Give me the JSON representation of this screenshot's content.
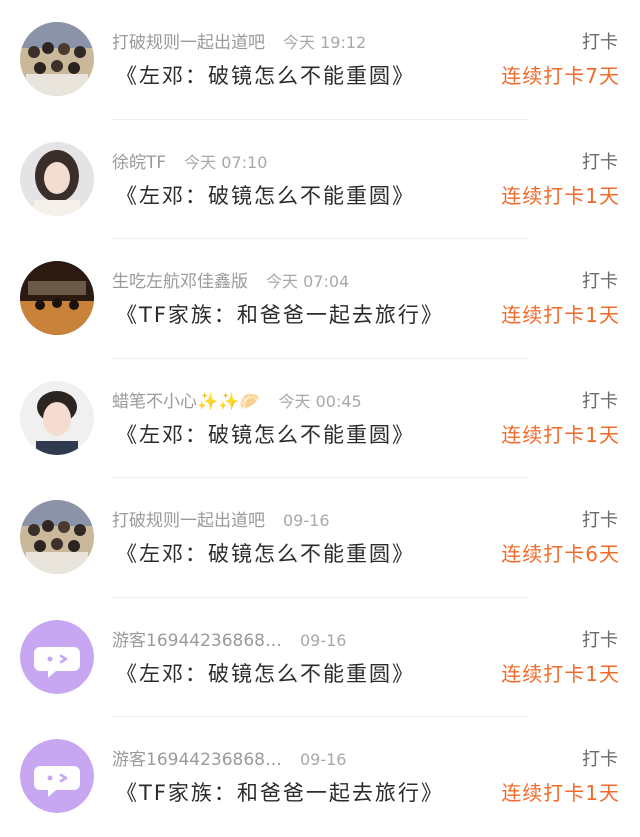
{
  "checkins": [
    {
      "avatar": "group-photo",
      "user": "打破规则一起出道吧",
      "time": "今天 19:12",
      "title": "《左邓：破镜怎么不能重圆》",
      "tag": "打卡",
      "streak": "连续打卡7天"
    },
    {
      "avatar": "girl-photo",
      "user": "徐皖TF",
      "time": "今天 07:10",
      "title": "《左邓：破镜怎么不能重圆》",
      "tag": "打卡",
      "streak": "连续打卡1天"
    },
    {
      "avatar": "stage-photo",
      "user": "生吃左航邓佳鑫版",
      "time": "今天 07:04",
      "title": "《TF家族：和爸爸一起去旅行》",
      "tag": "打卡",
      "streak": "连续打卡1天"
    },
    {
      "avatar": "boy-photo",
      "user": "蜡笔不小心✨✨🥟",
      "time": "今天 00:45",
      "title": "《左邓：破镜怎么不能重圆》",
      "tag": "打卡",
      "streak": "连续打卡1天"
    },
    {
      "avatar": "group-photo",
      "user": "打破规则一起出道吧",
      "time": "09-16",
      "title": "《左邓：破镜怎么不能重圆》",
      "tag": "打卡",
      "streak": "连续打卡6天"
    },
    {
      "avatar": "chat-bubble-icon",
      "user": "游客16944236868…",
      "time": "09-16",
      "title": "《左邓：破镜怎么不能重圆》",
      "tag": "打卡",
      "streak": "连续打卡1天"
    },
    {
      "avatar": "chat-bubble-icon",
      "user": "游客16944236868…",
      "time": "09-16",
      "title": "《TF家族：和爸爸一起去旅行》",
      "tag": "打卡",
      "streak": "连续打卡1天"
    }
  ],
  "colors": {
    "streak": "#f26a2a",
    "guest_avatar": "#c7a6f2"
  }
}
